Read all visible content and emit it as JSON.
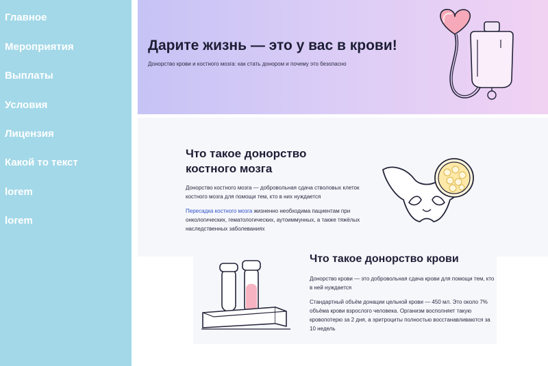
{
  "sidebar": {
    "items": [
      {
        "label": "Главное"
      },
      {
        "label": "Мероприятия"
      },
      {
        "label": "Выплаты"
      },
      {
        "label": "Условия"
      },
      {
        "label": "Лицензия"
      },
      {
        "label": "Какой то текст"
      },
      {
        "label": "lorem"
      },
      {
        "label": "lorem"
      }
    ]
  },
  "hero": {
    "title": "Дарите жизнь — это у вас в крови!",
    "subtitle": "Донорство крови и костного мозга: как стать донором и почему это безопасно",
    "icon": "blood-bag-heart-icon"
  },
  "bone_marrow": {
    "title": "Что такое донорство костного мозга",
    "paragraph1": "Донорство костного мозга — добровольная сдача стволовых клеток костного мозга для помощи тем, кто в них нуждается",
    "link_text": "Пересадка костного мозга",
    "paragraph2_rest": " жизненно необходима пациентам при онкологических, гематологических, аутоиммунных, а также тяжёлых наследственных заболеваниях",
    "icon": "pelvis-bone-icon"
  },
  "blood": {
    "title": "Что такое донорство крови",
    "paragraph1": "Донорство крови — это добровольная сдача крови для помощи тем, кто в ней нуждается",
    "paragraph2": "Стандартный объём донации цельной крови — 450 мл. Это около 7% объёма крови взрослого человека. Организм восполняет такую кровопотерю за 2 дня, а эритроциты полностью восстанавливаются за 10 недель",
    "icon": "test-tubes-icon"
  },
  "colors": {
    "sidebar_bg": "#a3d8e8",
    "hero_gradient_start": "#c6c3f5",
    "hero_gradient_end": "#f1d2f3",
    "accent_red": "#f08aa0",
    "link": "#2d4fc9"
  }
}
